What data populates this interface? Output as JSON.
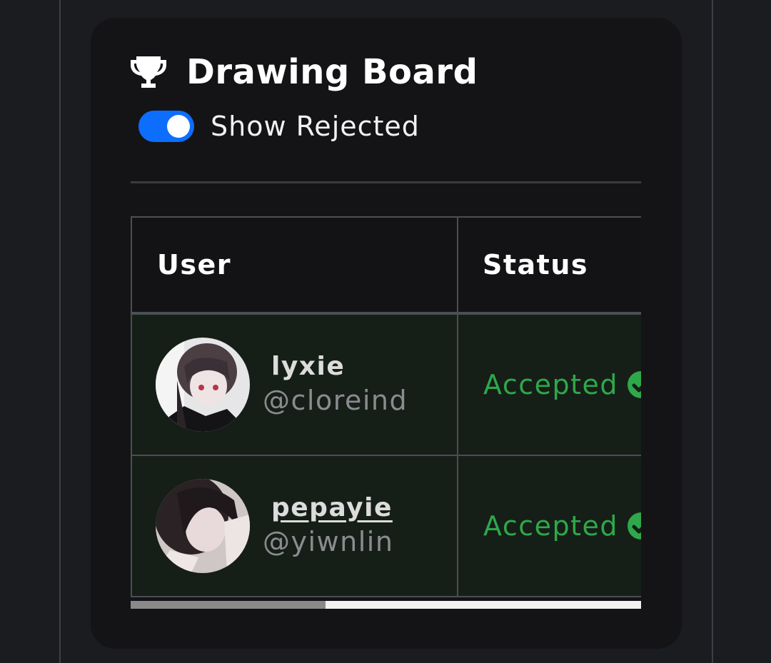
{
  "card": {
    "title": "Drawing Board",
    "title_icon": "trophy-icon"
  },
  "toggle": {
    "label": "Show Rejected",
    "checked": true,
    "color": "#0d6efd"
  },
  "table": {
    "headers": [
      "User",
      "Status"
    ],
    "rows": [
      {
        "name": "lyxie",
        "handle": "@cloreind",
        "status": "Accepted",
        "status_icon": "check-circle-icon"
      },
      {
        "name": "pepayie",
        "handle": "@yiwnlin",
        "status": "Accepted",
        "status_icon": "check-circle-icon"
      }
    ]
  },
  "colors": {
    "accepted": "#2ea84a",
    "row_bg": "#161e18"
  }
}
